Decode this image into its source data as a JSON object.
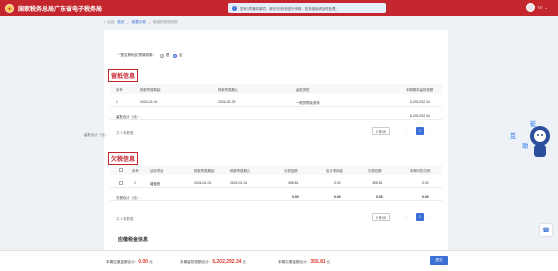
{
  "header": {
    "site_title": "国家税务总局广东省电子税务局",
    "notice_text": "您有3项通知事项，请在5月份前进行申报，若未缴纳请及时处理。",
    "user_name": "TE"
  },
  "breadcrumb": {
    "back": "< 返回",
    "items": [
      "首页",
      "我要办税",
      "增值税预缴税款"
    ],
    "sep": "/"
  },
  "radio": {
    "label": "* 是否跨地区预缴税款：",
    "options": [
      "是",
      "否"
    ],
    "selected": "否"
  },
  "section1": {
    "title": "留抵信息",
    "columns": [
      "序号",
      "税款所属期起",
      "税款所属期止",
      "留抵类型",
      "本期期末留抵税额"
    ],
    "rows": [
      {
        "no": "1",
        "start": "2024-02-01",
        "end": "2024-02-29",
        "type": "一般货物及劳务",
        "amount": "6,202,292.34"
      }
    ],
    "sum_label": "留抵合计（元）:",
    "sum_value": "6,202,292.34",
    "total": "共 1 条数据",
    "page_size": "5 条/页",
    "page": "1"
  },
  "section2": {
    "title": "欠税信息",
    "columns": [
      "序号",
      "征收项目",
      "税款所属期起",
      "税款所属期止",
      "欠税金额",
      "应计滞纳金",
      "欠税总额",
      "本期可抵欠税"
    ],
    "rows": [
      {
        "no": "1",
        "item": "增值税",
        "start": "2024-01-01",
        "end": "2024-01-31",
        "owe": "355.81",
        "late_fee": "0.00",
        "total": "355.81",
        "deduct": "0.00"
      }
    ],
    "sum_label": "欠税合计（元）:",
    "sum_values": [
      "0.00",
      "0.00",
      "0.00",
      "0.00"
    ],
    "total": "共 1 条数据",
    "page_size": "5 条/页",
    "page": "1"
  },
  "side_label": "留抵合计（元）:",
  "lower_title": "应缴税金信息",
  "footer": {
    "paid_label": "本期应缴金额合计：",
    "paid_value": "0.00",
    "paid_unit": "元",
    "retain_label": "本期留抵税额合计：",
    "retain_value": "6,202,292.34",
    "retain_unit": "元",
    "owe_label": "本期欠缴金额合计：",
    "owe_value": "355.81",
    "owe_unit": "元",
    "submit": "提交"
  },
  "mascot_text": [
    "征",
    "互",
    "动"
  ],
  "colors": {
    "brand_red": "#c4262e",
    "accent_blue": "#3b6fd6",
    "warn_red": "#e0392d"
  }
}
